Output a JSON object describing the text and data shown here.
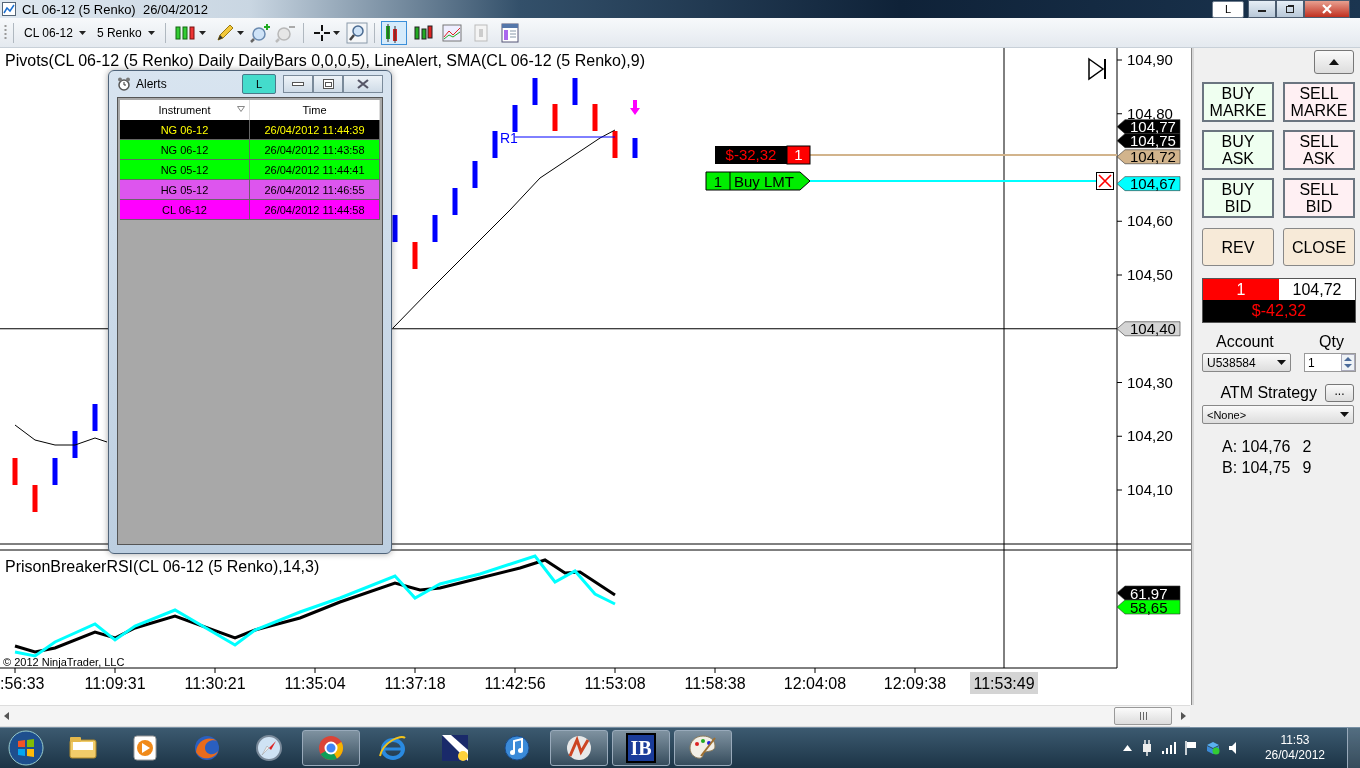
{
  "window": {
    "title": "CL 06-12 (5 Renko)  26/04/2012",
    "button": "L"
  },
  "toolbar": {
    "instrument": "CL 06-12",
    "interval": "5 Renko",
    "view_buttons": [
      {
        "selected": true
      },
      {
        "selected": false
      },
      {
        "selected": false
      },
      {
        "selected": false
      },
      {
        "selected": false
      }
    ]
  },
  "price_panel": {
    "indicator_label": "Pivots(CL 06-12 (5 Renko) Daily DailyBars 0,0,0,5), LineAlert, SMA(CL 06-12 (5 Renko),9)",
    "pivot_label": "R1",
    "price_labels": [
      "104,90",
      "104,80",
      "104,60",
      "104,50",
      "104,30",
      "104,20",
      "104,10"
    ],
    "price_tags": [
      {
        "text": "104,77",
        "color": "#000000"
      },
      {
        "text": "104,75",
        "color": "#000000"
      },
      {
        "text": "104,72",
        "color": "#d2b48c"
      },
      {
        "text": "104,67",
        "color": "#00ffff"
      },
      {
        "text": "104,40",
        "color": "#d4d4d4"
      }
    ],
    "position_line": {
      "pnl": "$-32,32",
      "quantity": "1",
      "color": "#d2b48c"
    },
    "order_line": {
      "quantity": "1",
      "label": "Buy LMT",
      "color": "#00ffff"
    }
  },
  "rsi_panel": {
    "label": "PrisonBreakerRSI(CL 06-12 (5 Renko),14,3)",
    "value_tags": [
      {
        "text": "61,97",
        "color": "#000000"
      },
      {
        "text": "58,65",
        "color": "#00ff00"
      }
    ]
  },
  "copyright": "© 2012 NinjaTrader, LLC",
  "time_axis": {
    "labels": [
      ":56:33",
      "11:09:31",
      "11:30:21",
      "11:35:04",
      "11:37:18",
      "11:42:56",
      "11:53:08",
      "11:58:38",
      "12:04:08",
      "12:09:38"
    ],
    "cursor_time": "11:53:49"
  },
  "alerts": {
    "title": "Alerts",
    "button": "L",
    "columns": [
      "Instrument",
      "Time"
    ],
    "rows": [
      {
        "instrument": "NG 06-12",
        "time": "26/04/2012 11:44:39",
        "color": "#000000"
      },
      {
        "instrument": "NG 06-12",
        "time": "26/04/2012 11:43:58",
        "color": "#00ff00"
      },
      {
        "instrument": "NG 05-12",
        "time": "26/04/2012 11:44:41",
        "color": "#00ff00"
      },
      {
        "instrument": "HG 05-12",
        "time": "26/04/2012 11:46:55",
        "color": "#dd55ee"
      },
      {
        "instrument": "CL 06-12",
        "time": "26/04/2012 11:44:58",
        "color": "#ff00ff"
      }
    ]
  },
  "order_panel": {
    "buttons": [
      {
        "label": "BUY MARKE",
        "kind": "buy"
      },
      {
        "label": "SELL MARKE",
        "kind": "sell"
      },
      {
        "label": "BUY ASK",
        "kind": "buy"
      },
      {
        "label": "SELL ASK",
        "kind": "sell"
      },
      {
        "label": "BUY BID",
        "kind": "buy"
      },
      {
        "label": "SELL BID",
        "kind": "sell"
      },
      {
        "label": "REV",
        "kind": "neutral"
      },
      {
        "label": "CLOSE",
        "kind": "neutral"
      }
    ],
    "position": {
      "quantity": "1",
      "avg_price": "104,72",
      "pnl": "$-42,32"
    },
    "account": {
      "label": "Account",
      "value": "U538584"
    },
    "qty": {
      "label": "Qty",
      "value": "1"
    },
    "atm": {
      "label": "ATM Strategy",
      "button": "...",
      "value": "<None>"
    },
    "quotes": [
      {
        "label": "A: 104,76",
        "size": "2"
      },
      {
        "label": "B: 104,75",
        "size": "9"
      }
    ]
  },
  "taskbar": {
    "apps": [
      {
        "kind": "folder",
        "active": false
      },
      {
        "kind": "media",
        "active": false
      },
      {
        "kind": "firefox",
        "active": false
      },
      {
        "kind": "safari",
        "active": false
      },
      {
        "kind": "chrome",
        "active": true
      },
      {
        "kind": "ie",
        "active": false
      },
      {
        "kind": "flag",
        "active": false
      },
      {
        "kind": "itunes",
        "active": false
      },
      {
        "kind": "ninja",
        "active": true
      },
      {
        "kind": "ib",
        "active": true,
        "text": "IB"
      },
      {
        "kind": "paint",
        "active": true
      }
    ],
    "clock": {
      "time": "11:53",
      "date": "26/04/2012"
    }
  }
}
